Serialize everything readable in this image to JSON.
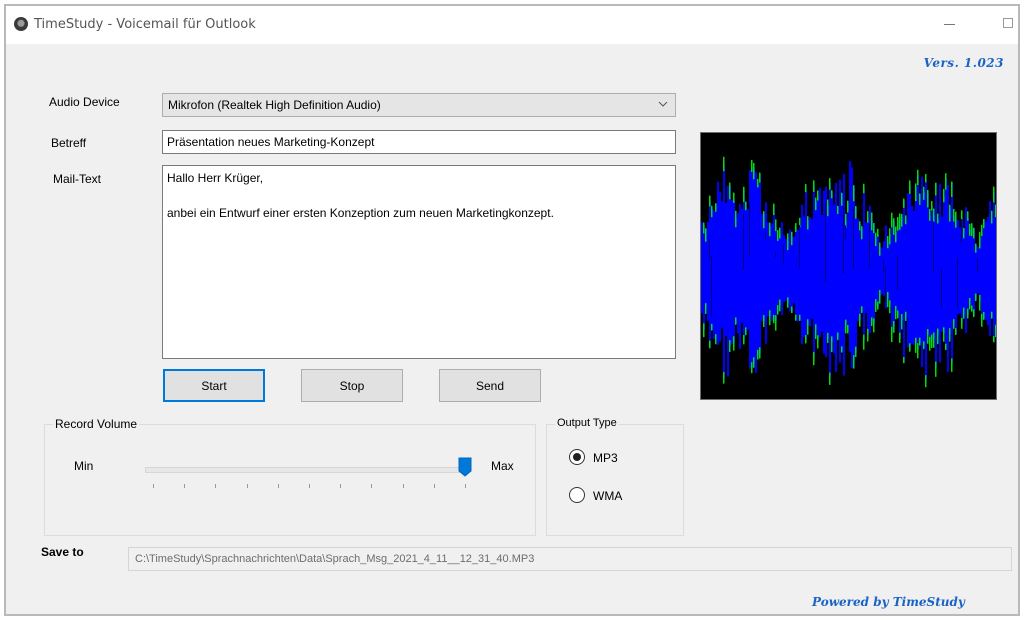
{
  "window": {
    "title": "TimeStudy - Voicemail für Outlook",
    "version": "Vers. 1.023",
    "powered_by": "Powered by TimeStudy"
  },
  "form": {
    "audio_device_label": "Audio Device",
    "audio_device_value": "Mikrofon (Realtek High Definition Audio)",
    "subject_label": "Betreff",
    "subject_value": "Präsentation neues Marketing-Konzept",
    "mailtext_label": "Mail-Text",
    "mailtext_lines": [
      "Hallo Herr Krüger,",
      "anbei ein Entwurf einer ersten Konzeption zum neuen Marketingkonzept."
    ]
  },
  "buttons": {
    "start": "Start",
    "stop": "Stop",
    "send": "Send"
  },
  "record_volume": {
    "title": "Record Volume",
    "min_label": "Min",
    "max_label": "Max",
    "value_fraction": 1.0,
    "tick_count": 11
  },
  "output_type": {
    "title": "Output Type",
    "options": [
      {
        "label": "MP3",
        "checked": true
      },
      {
        "label": "WMA",
        "checked": false
      }
    ]
  },
  "save_to": {
    "label": "Save to",
    "path": "C:\\TimeStudy\\Sprachnachrichten\\Data\\Sprach_Msg_2021_4_11__12_31_40.MP3"
  },
  "waveform": {
    "background": "#000000",
    "fill_color": "#0000ff",
    "peak_color": "#00e000",
    "dark_line_color": "#000080"
  },
  "colors": {
    "accent": "#0078d7",
    "brand_text": "#1a63c6"
  }
}
